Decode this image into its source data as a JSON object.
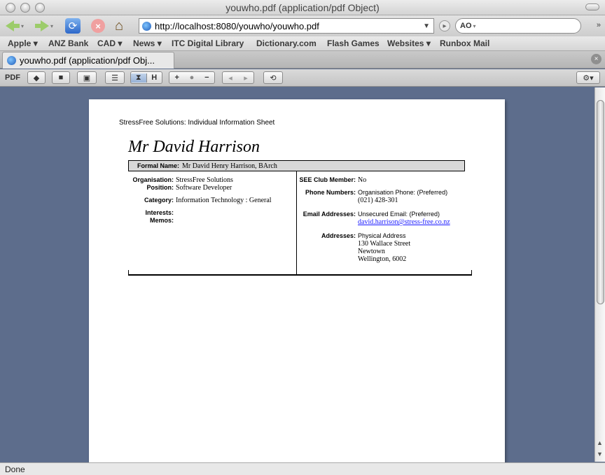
{
  "window": {
    "title": "youwho.pdf (application/pdf Object)"
  },
  "nav": {
    "url": "http://localhost:8080/youwho/youwho.pdf",
    "search_engine": "AO"
  },
  "bookmarks": [
    "Apple",
    "ANZ Bank",
    "CAD",
    "News",
    "ITC Digital Library",
    "Dictionary.com",
    "Flash Games",
    "Websites",
    "Runbox Mail"
  ],
  "bookmark_menus": [
    "▾",
    "",
    "▾",
    "▾",
    "",
    "",
    "",
    "▾",
    ""
  ],
  "tab": {
    "title": "youwho.pdf (application/pdf Obj..."
  },
  "pdf_toolbar": {
    "label": "PDF",
    "fit_width": "H",
    "zoom_in": "+",
    "zoom_out": "−"
  },
  "document": {
    "header": "StressFree Solutions: Individual Information Sheet",
    "name": "Mr David Harrison",
    "formal_name_label": "Formal Name:",
    "formal_name": "Mr David Henry Harrison, BArch",
    "left": {
      "organisation_label": "Organisation:",
      "organisation": "StressFree Solutions",
      "position_label": "Position:",
      "position": "Software Developer",
      "category_label": "Category:",
      "category": "Information Technology : General",
      "interests_label": "Interests:",
      "memos_label": "Memos:"
    },
    "right": {
      "club_label": "SEE Club Member:",
      "club": "No",
      "phone_label": "Phone Numbers:",
      "phone_type": "Organisation Phone: (Preferred)",
      "phone": "(021) 428-301",
      "email_label": "Email Addresses:",
      "email_type": "Unsecured Email: (Preferred)",
      "email": "david.harrison@stress-free.co.nz",
      "address_label": "Addresses:",
      "address_type": "Physical Address",
      "address_line1": "130 Wallace Street",
      "address_line2": "Newtown",
      "address_line3": "Wellington, 6002"
    }
  },
  "status": {
    "text": "Done"
  }
}
